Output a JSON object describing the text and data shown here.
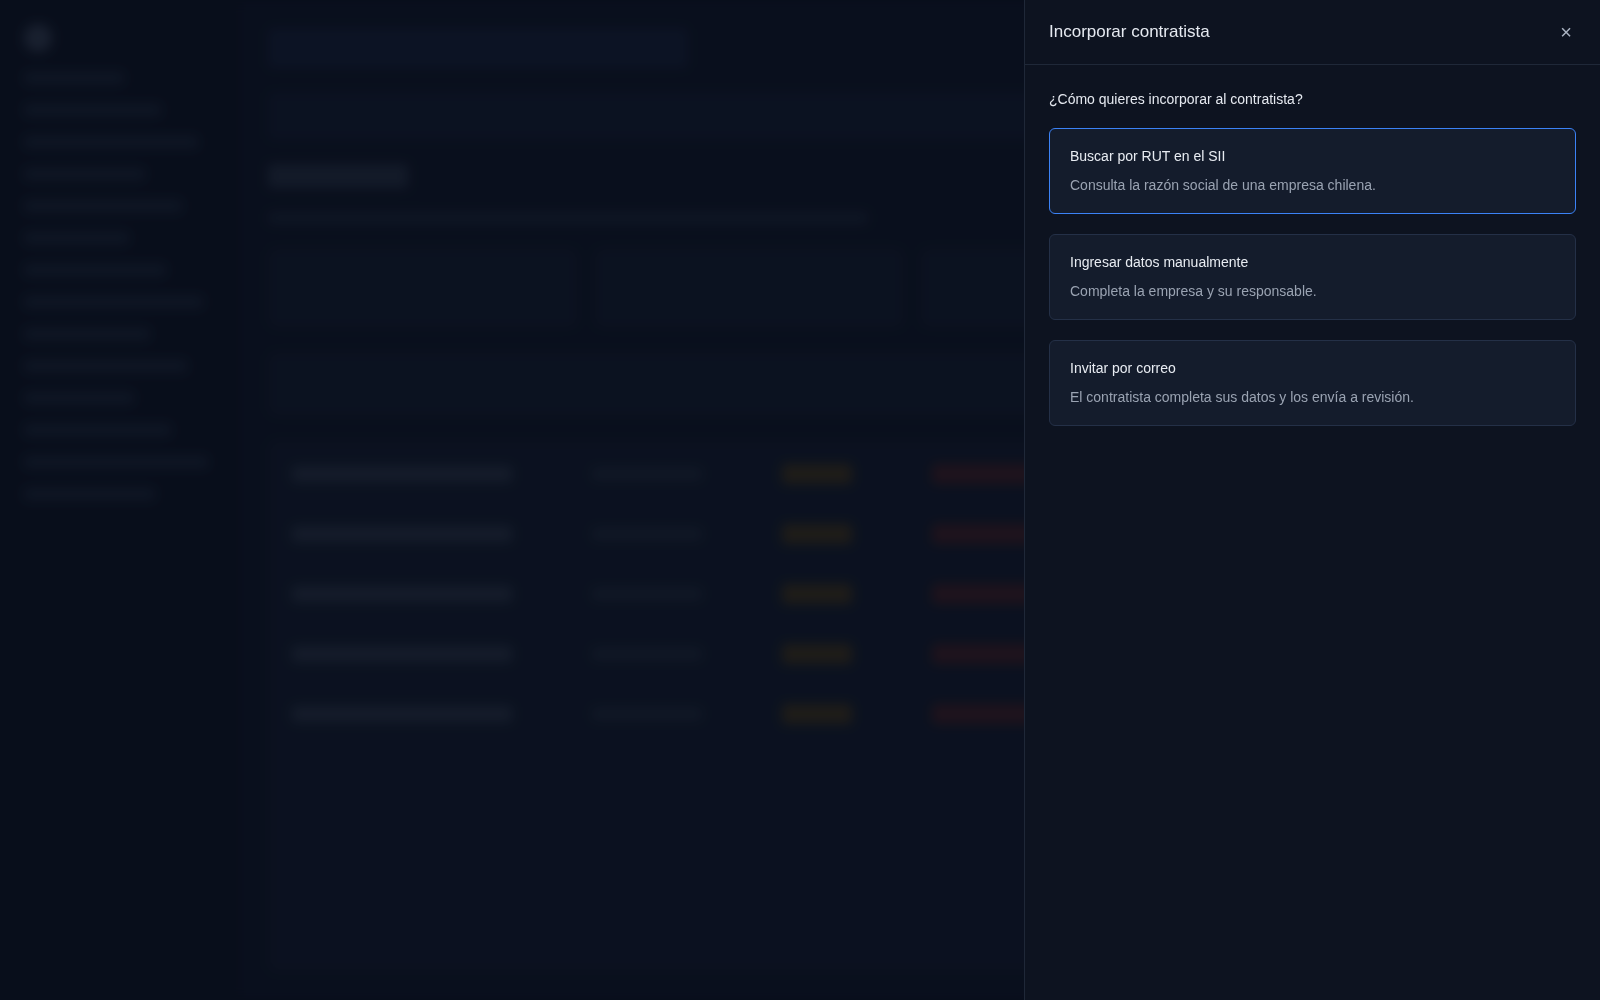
{
  "drawer": {
    "title": "Incorporar contratista",
    "close": "×",
    "question": "¿Cómo quieres incorporar al contratista?",
    "options": [
      {
        "title": "Buscar por RUT en el SII",
        "description": "Consulta la razón social de una empresa chilena.",
        "selected": true
      },
      {
        "title": "Ingresar datos manualmente",
        "description": "Completa la empresa y su responsable.",
        "selected": false
      },
      {
        "title": "Invitar por correo",
        "description": "El contratista completa sus datos y los envía a revisión.",
        "selected": false
      }
    ]
  }
}
